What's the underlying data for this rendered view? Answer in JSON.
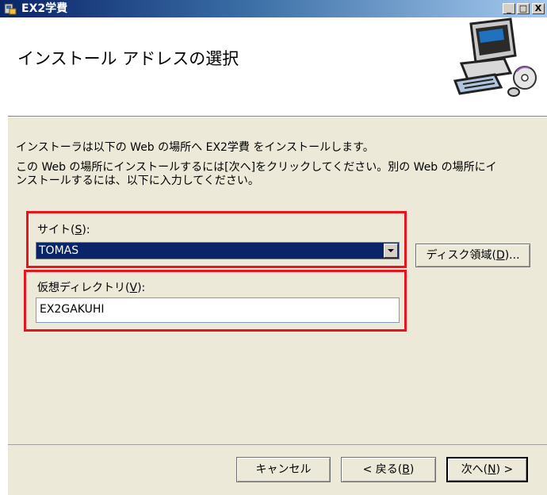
{
  "window": {
    "title": "EX2学費",
    "controls": {
      "minimize": "_",
      "maximize": "□",
      "close": "X"
    }
  },
  "header": {
    "title": "インストール アドレスの選択",
    "art_icon": "computer-cd-icon"
  },
  "body": {
    "intro": "インストーラは以下の Web の場所へ EX2学費 をインストールします。",
    "description_line1": "この Web の場所にインストールするには[次へ]をクリックしてください。別の Web の場所にイ",
    "description_line2": "ンストールするには、以下に入力してください。"
  },
  "site": {
    "label_prefix": "サイト(",
    "label_key": "S",
    "label_suffix": "):",
    "value": "TOMAS"
  },
  "disk_button": {
    "label_prefix": "ディスク領域(",
    "label_key": "D",
    "label_suffix": ")..."
  },
  "vdir": {
    "label_prefix": "仮想ディレクトリ(",
    "label_key": "V",
    "label_suffix": "):",
    "value": "EX2GAKUHI"
  },
  "buttons": {
    "cancel": "キャンセル",
    "back_prefix": "< 戻る(",
    "back_key": "B",
    "back_suffix": ")",
    "next_prefix": "次へ(",
    "next_key": "N",
    "next_suffix": ") >"
  },
  "colors": {
    "highlight": "#e8141e",
    "selection": "#0a246a",
    "face": "#ece9d8"
  }
}
